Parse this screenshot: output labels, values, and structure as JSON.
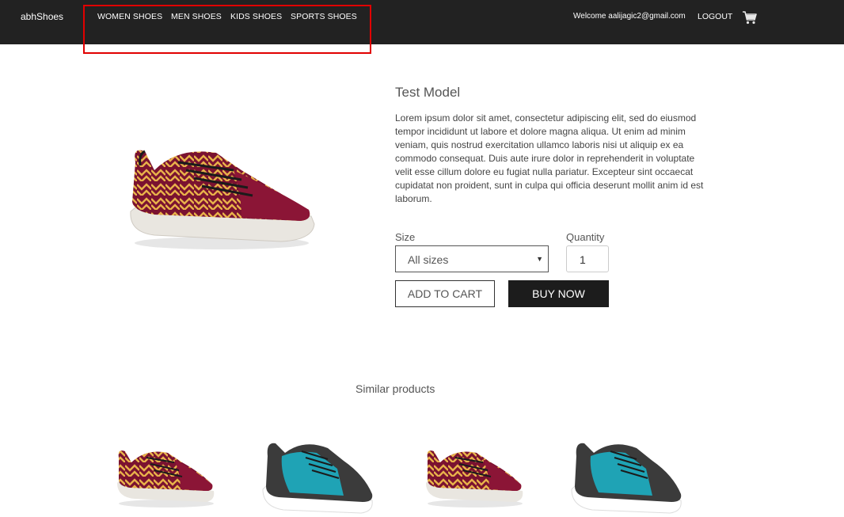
{
  "navbar": {
    "brand": "abhShoes",
    "links": [
      "WOMEN SHOES",
      "MEN SHOES",
      "KIDS SHOES",
      "SPORTS SHOES"
    ],
    "welcome": "Welcome aalijagic2@gmail.com",
    "logout": "LOGOUT",
    "cart_icon": "shopping-cart-icon"
  },
  "product": {
    "title": "Test Model",
    "description": "Lorem ipsum dolor sit amet, consectetur adipiscing elit, sed do eiusmod tempor incididunt ut labore et dolore magna aliqua. Ut enim ad minim veniam, quis nostrud exercitation ullamco laboris nisi ut aliquip ex ea commodo consequat. Duis aute irure dolor in reprehenderit in voluptate velit esse cillum dolore eu fugiat nulla pariatur. Excepteur sint occaecat cupidatat non proident, sunt in culpa qui officia deserunt mollit anim id est laborum.",
    "size_label": "Size",
    "size_value": "All sizes",
    "quantity_label": "Quantity",
    "quantity_value": "1",
    "add_to_cart": "ADD TO CART",
    "buy_now": "BUY NOW"
  },
  "similar": {
    "heading": "Similar products"
  },
  "colors": {
    "navbar_bg": "#222222",
    "highlight_border": "#e10000",
    "buy_button_bg": "#1c1c1c"
  }
}
